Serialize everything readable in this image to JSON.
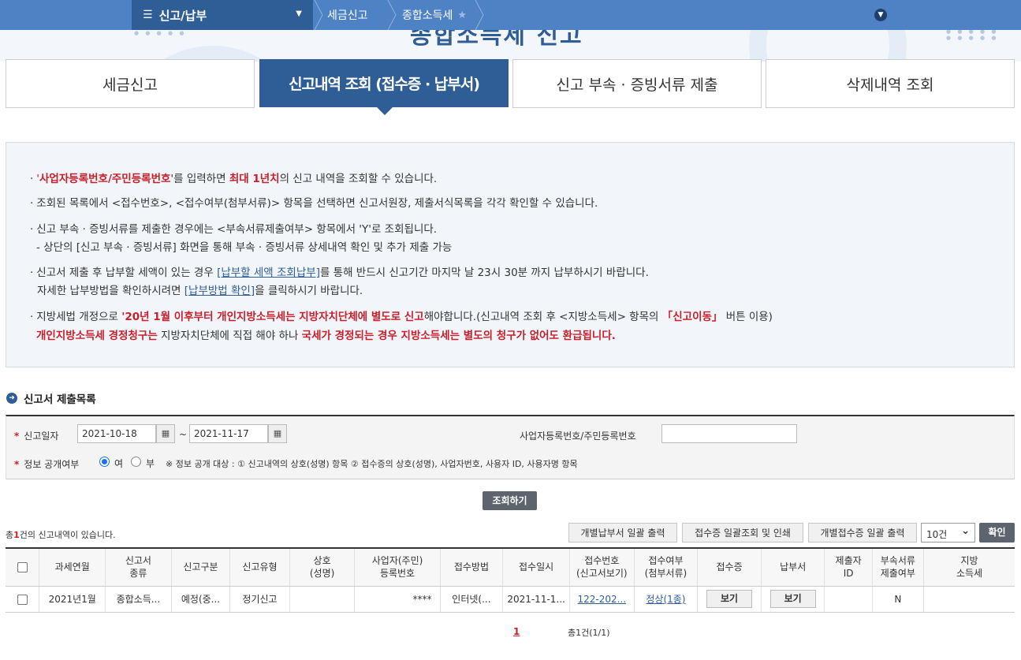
{
  "topnav": {
    "menu_label": "신고/납부",
    "crumb1": "세금신고",
    "crumb2": "종합소득세"
  },
  "banner": {
    "title_fragment": "종합소득세 신고"
  },
  "tabs": [
    {
      "label": "세금신고"
    },
    {
      "label": "신고내역 조회 (접수증 · 납부서)"
    },
    {
      "label": "신고 부속 · 증빙서류 제출"
    },
    {
      "label": "삭제내역 조회"
    }
  ],
  "info": {
    "l1_a": "'",
    "l1_b": "사업자등록번호/주민등록번호",
    "l1_c": "'를 입력하면 ",
    "l1_d": "최대 1년치",
    "l1_e": "의 신고 내역을 조회할 수 있습니다.",
    "l2": "조회된 목록에서 <접수번호>, <접수여부(첨부서류)> 항목을 선택하면 신고서원장, 제출서식목록을 각각 확인할 수 있습니다.",
    "l3": "신고 부속 · 증빙서류를 제출한 경우에는 <부속서류제출여부> 항목에서 'Y'로 조회됩니다.",
    "l3b": "- 상단의 [신고 부속 · 증빙서류] 화면을 통해 부속 · 증빙서류 상세내역 확인 및 추가 제출 가능",
    "l4_a": "신고서 제출 후 납부할 세액이 있는 경우 ",
    "l4_link": "[납부할 세액 조회납부]",
    "l4_b": "를 통해 반드시 신고기간 마지막 날 23시 30분 까지 납부하시기 바랍니다.",
    "l4c_a": "자세한 납부방법을 확인하시려면 ",
    "l4c_link": "[납부방법 확인]",
    "l4c_b": "을 클릭하시기 바랍니다.",
    "l5_a": "지방세법 개정으로 ",
    "l5_b": "'20년 1월 이후부터 개인지방소득세는 지방자치단체에 별도로 신고",
    "l5_c": "해야합니다.(신고내역 조회 후 <지방소득세> 항목의 ",
    "l5_d": "「신고이동」",
    "l5_e": " 버튼 이용)",
    "l6_a": "개인지방소득세 경정청구는",
    "l6_b": " 지방자치단체에 직접 해야 하나 ",
    "l6_c": "국세가 경정되는 경우 지방소득세는 별도의 청구가 없어도 환급됩니다."
  },
  "section_title": "신고서 제출목록",
  "search": {
    "date_label": "신고일자",
    "date_from": "2021-10-18",
    "date_to": "2021-11-17",
    "tilde": "~",
    "id_label": "사업자등록번호/주민등록번호",
    "id_value": "",
    "public_label": "정보 공개여부",
    "yes": "여",
    "no": "부",
    "note": "※ 정보 공개 대상 : ① 신고내역의 상호(성명) 항목 ② 접수증의 상호(성명), 사업자번호, 사용자 ID, 사용자명 항목"
  },
  "search_button": "조회하기",
  "result": {
    "count_prefix": "총",
    "count": "1",
    "count_suffix": "건의 신고내역이 있습니다.",
    "btn_print_payment": "개별납부서 일괄 출력",
    "btn_receipt_print": "접수증 일괄조회 및 인쇄",
    "btn_receipt_each": "개별접수증 일괄 출력",
    "page_size": "10건",
    "confirm": "확인"
  },
  "table": {
    "headers": [
      "과세연월",
      "신고서\n종류",
      "신고구분",
      "신고유형",
      "상호\n(성명)",
      "사업자(주민)\n등록번호",
      "접수방법",
      "접수일시",
      "접수번호\n(신고서보기)",
      "접수여부\n(첨부서류)",
      "접수증",
      "납부서",
      "제출자\nID",
      "부속서류\n제출여부",
      "지방\n소득세"
    ],
    "rows": [
      {
        "period": "2021년1월",
        "kind": "종합소득...",
        "div": "예정(중...",
        "type": "정기신고",
        "name": "",
        "regno": "****",
        "method": "인터넷(...",
        "date": "2021-11-1...",
        "receipt_no": "122-202...",
        "status": "정상(1종)",
        "receipt_btn": "보기",
        "payment_btn": "보기",
        "submitter": "",
        "attach": "N",
        "local_tax": ""
      }
    ]
  },
  "pager": {
    "page": "1",
    "total": "총1건(1/1)"
  },
  "colors": {
    "primary": "#2f5e96",
    "nav": "#4d82c4",
    "accent_red": "#c8202b"
  }
}
